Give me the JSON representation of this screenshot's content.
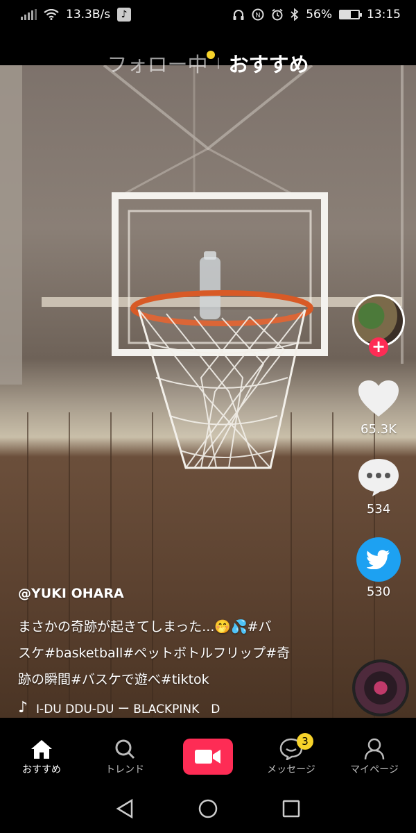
{
  "status_bar": {
    "network_speed": "13.3B/s",
    "battery_percent": "56%",
    "battery_level": 0.56,
    "time": "13:15",
    "icons": [
      "signal-icon",
      "wifi-icon",
      "music-app-icon",
      "headphones-icon",
      "data-saver-icon",
      "alarm-icon",
      "bluetooth-icon",
      "battery-icon"
    ]
  },
  "top_tabs": {
    "following": "フォロー中",
    "recommended": "おすすめ"
  },
  "right_rail": {
    "follow_symbol": "+",
    "likes": "65.3K",
    "comments": "534",
    "shares": "530"
  },
  "caption": {
    "username": "@YUKI OHARA",
    "line1": "まさかの奇跡が起きてしまった...🤭💦#バ",
    "line2": "スケ#basketball#ペットボトルフリップ#奇",
    "line3": "跡の瞬間#バスケで遊べ#tiktok"
  },
  "music": {
    "text": "I-DU DDU-DU ー BLACKPINK　D"
  },
  "bottom_nav": {
    "home": "おすすめ",
    "trend": "トレンド",
    "messages": "メッセージ",
    "messages_badge": "3",
    "mypage": "マイページ"
  },
  "colors": {
    "accent_red": "#fe2c55",
    "badge_yellow": "#f7d32a",
    "twitter_blue": "#1da1f2"
  }
}
